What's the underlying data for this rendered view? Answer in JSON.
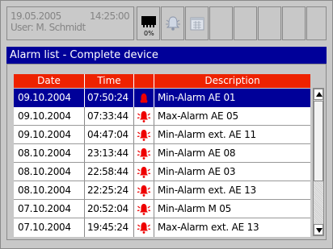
{
  "status": {
    "date": "19.05.2005",
    "time": "14:25:00",
    "user": "User: M. Schmidt"
  },
  "toolbar": {
    "memory_percent": "0%"
  },
  "title": "Alarm list - Complete device",
  "table": {
    "headers": [
      "Date",
      "Time",
      "",
      "Description"
    ],
    "rows": [
      {
        "date": "09.10.2004",
        "time": "07:50:24",
        "icon": "alarm-active-icon",
        "desc": "Min-Alarm AE 01"
      },
      {
        "date": "09.10.2004",
        "time": "07:33:44",
        "icon": "alarm-bell-icon",
        "desc": "Max-Alarm AE 05"
      },
      {
        "date": "09.10.2004",
        "time": "04:47:04",
        "icon": "alarm-bell-icon",
        "desc": "Min-Alarm ext. AE 11"
      },
      {
        "date": "08.10.2004",
        "time": "23:13:44",
        "icon": "alarm-bell-icon",
        "desc": "Min-Alarm AE 08"
      },
      {
        "date": "08.10.2004",
        "time": "22:58:44",
        "icon": "alarm-bell-icon",
        "desc": "Min-Alarm AE 03"
      },
      {
        "date": "08.10.2004",
        "time": "22:25:24",
        "icon": "alarm-bell-icon",
        "desc": "Min-Alarm ext. AE 13"
      },
      {
        "date": "07.10.2004",
        "time": "20:52:04",
        "icon": "alarm-bell-icon",
        "desc": "Min-Alarm M 05"
      },
      {
        "date": "07.10.2004",
        "time": "19:45:24",
        "icon": "alarm-bell-icon",
        "desc": "Max-Alarm ext. AE 13"
      }
    ]
  },
  "colors": {
    "title_bar": "#000099",
    "header": "#ee2200",
    "selected_row": "#000099",
    "alarm_red": "#ee0000"
  }
}
